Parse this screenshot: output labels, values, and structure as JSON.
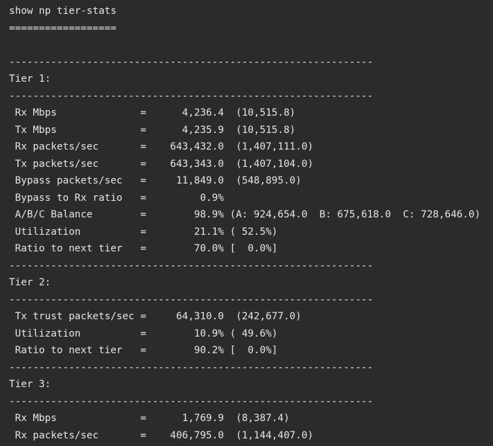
{
  "command": "show np tier-stats",
  "underline": "==================",
  "separator": "-------------------------------------------------------------",
  "tiers": [
    {
      "title": "Tier 1:",
      "rows": [
        " Rx Mbps              =      4,236.4  (10,515.8)",
        " Tx Mbps              =      4,235.9  (10,515.8)",
        " Rx packets/sec       =    643,432.0  (1,407,111.0)",
        " Tx packets/sec       =    643,343.0  (1,407,104.0)",
        " Bypass packets/sec   =     11,849.0  (548,895.0)",
        " Bypass to Rx ratio   =         0.9%",
        " A/B/C Balance        =        98.9% (A: 924,654.0  B: 675,618.0  C: 728,646.0)",
        " Utilization          =        21.1% ( 52.5%)",
        " Ratio to next tier   =        70.0% [  0.0%]"
      ]
    },
    {
      "title": "Tier 2:",
      "rows": [
        " Tx trust packets/sec =     64,310.0  (242,677.0)",
        " Utilization          =        10.9% ( 49.6%)",
        " Ratio to next tier   =        90.2% [  0.0%]"
      ]
    },
    {
      "title": "Tier 3:",
      "rows": [
        " Rx Mbps              =      1,769.9  (8,387.4)",
        " Rx packets/sec       =    406,795.0  (1,144,407.0)"
      ]
    }
  ]
}
